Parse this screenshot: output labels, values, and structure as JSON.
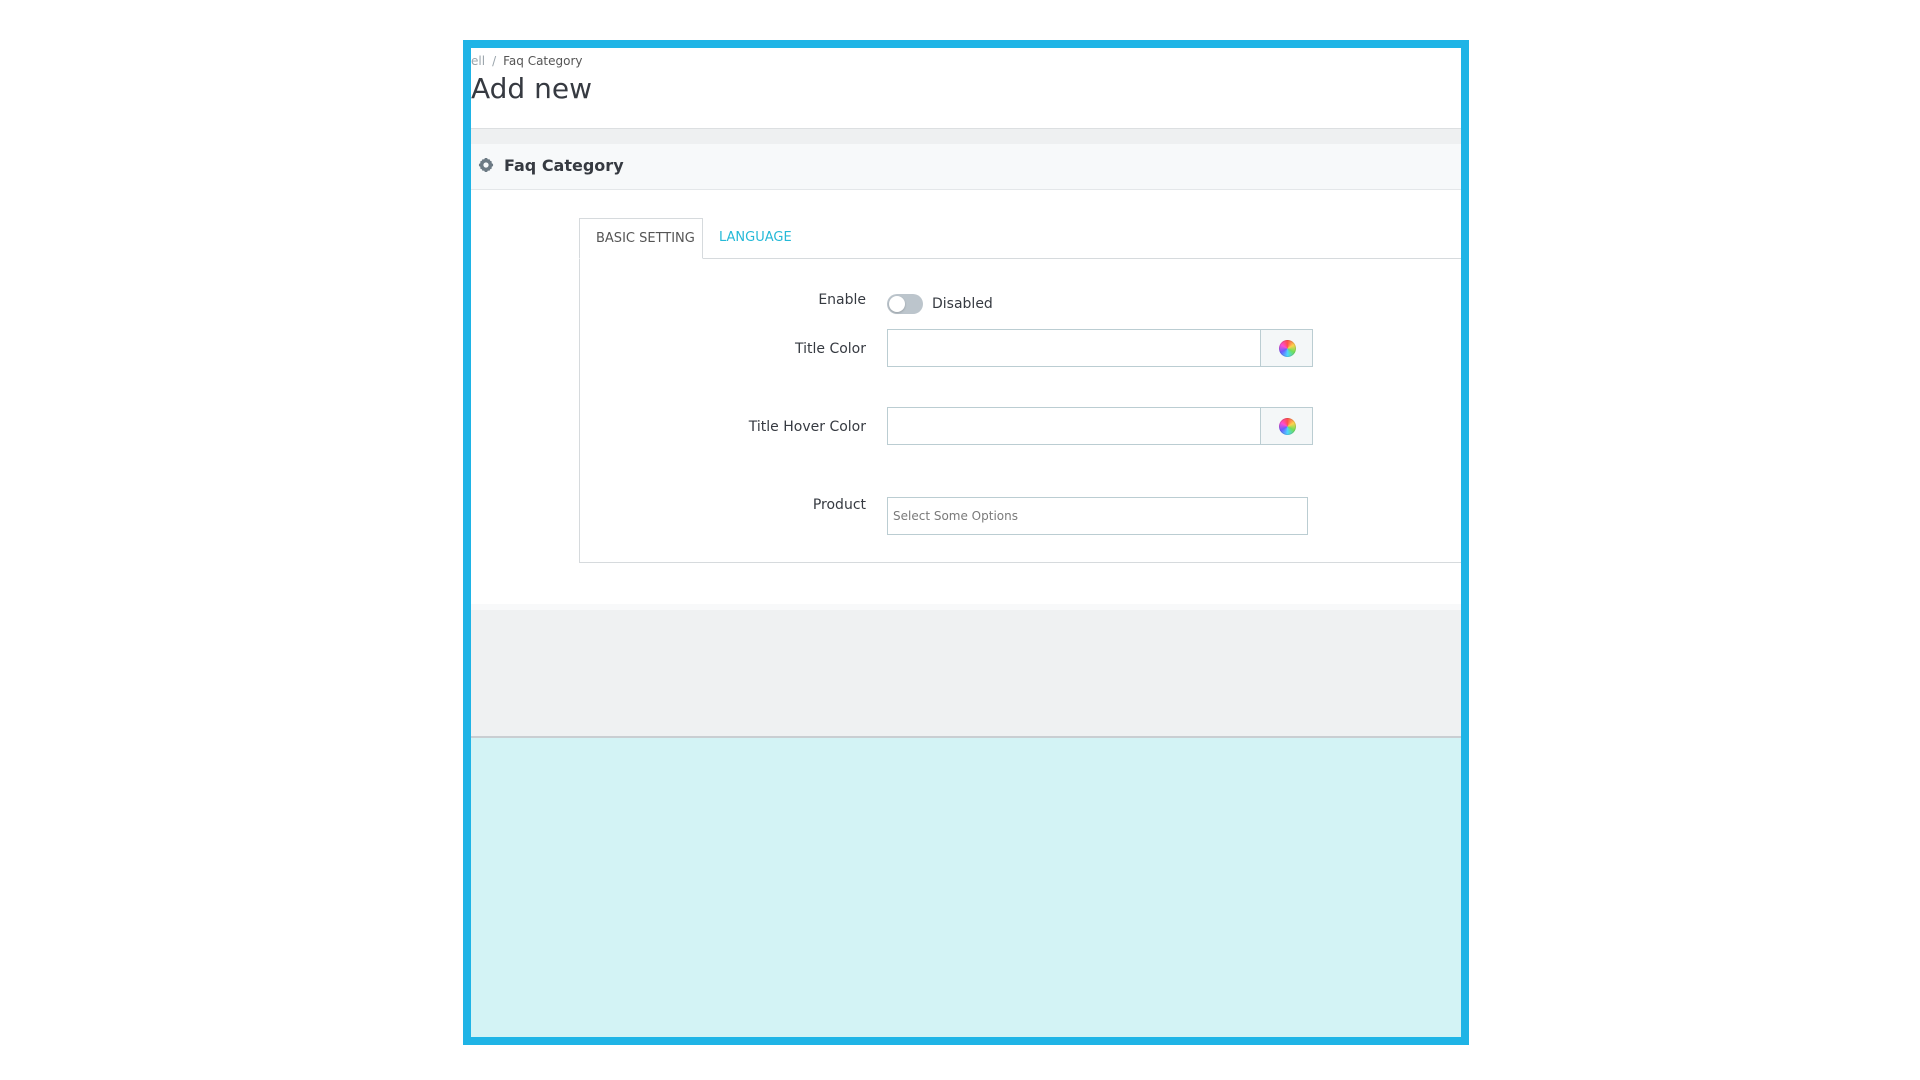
{
  "breadcrumb": {
    "previous": "ell",
    "separator": "/",
    "current": "Faq Category"
  },
  "page_title": "Add new",
  "panel": {
    "title": "Faq Category",
    "icon": "gear-icon"
  },
  "tabs": [
    {
      "label": "BASIC SETTING",
      "active": true
    },
    {
      "label": "LANGUAGE",
      "active": false
    }
  ],
  "form": {
    "enable": {
      "label": "Enable",
      "state_text": "Disabled",
      "value": false
    },
    "title_color": {
      "label": "Title Color",
      "value": "",
      "icon": "color-wheel-icon"
    },
    "title_hover_color": {
      "label": "Title Hover Color",
      "value": "",
      "icon": "color-wheel-icon"
    },
    "product": {
      "label": "Product",
      "placeholder": "Select Some Options"
    }
  },
  "colors": {
    "frame_border": "#1fb4e6",
    "accent": "#25b9d7",
    "bottom_area": "#d3f3f5"
  }
}
